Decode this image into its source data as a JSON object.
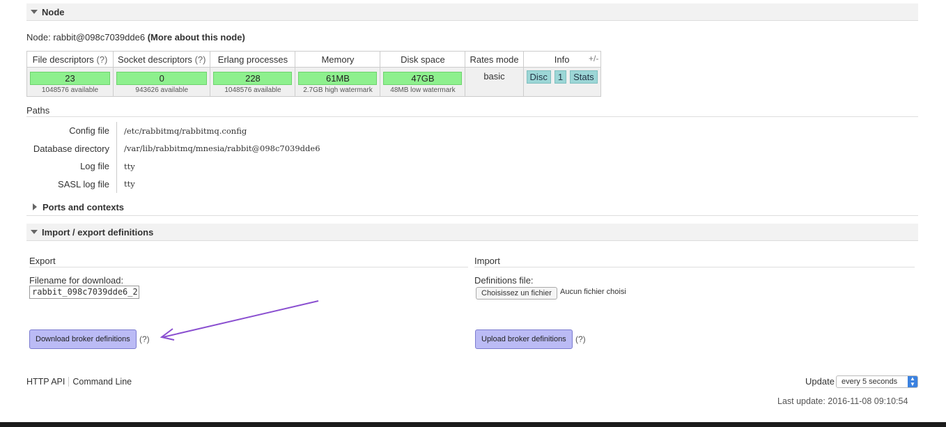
{
  "node_section": {
    "title": "Node",
    "node_prefix": "Node: ",
    "node_name": "rabbit@098c7039dde6",
    "more_link": "(More about this node)",
    "columns": [
      {
        "label": "File descriptors",
        "help": "(?)"
      },
      {
        "label": "Socket descriptors",
        "help": "(?)"
      },
      {
        "label": "Erlang processes",
        "help": ""
      },
      {
        "label": "Memory",
        "help": ""
      },
      {
        "label": "Disk space",
        "help": ""
      },
      {
        "label": "Rates mode",
        "help": ""
      },
      {
        "label": "Info",
        "help": ""
      }
    ],
    "file_descriptors": {
      "value": "23",
      "sub": "1048576 available"
    },
    "socket_descriptors": {
      "value": "0",
      "sub": "943626 available"
    },
    "erlang_processes": {
      "value": "228",
      "sub": "1048576 available"
    },
    "memory": {
      "value": "61MB",
      "sub": "2.7GB high watermark"
    },
    "disk_space": {
      "value": "47GB",
      "sub": "48MB low watermark"
    },
    "rates_mode": "basic",
    "info_badges": [
      "Disc",
      "1",
      "Stats"
    ],
    "plus_minus": "+/-"
  },
  "paths": {
    "title": "Paths",
    "rows": [
      {
        "key": "Config file",
        "value": "/etc/rabbitmq/rabbitmq.config"
      },
      {
        "key": "Database directory",
        "value": "/var/lib/rabbitmq/mnesia/rabbit@098c7039dde6"
      },
      {
        "key": "Log file",
        "value": "tty"
      },
      {
        "key": "SASL log file",
        "value": "tty"
      }
    ]
  },
  "ports_section": {
    "title": "Ports and contexts"
  },
  "import_export": {
    "title": "Import / export definitions",
    "export": {
      "heading": "Export",
      "filename_label": "Filename for download:",
      "filename_value": "rabbit_098c7039dde6_2",
      "button": "Download broker definitions",
      "help": "(?)"
    },
    "import": {
      "heading": "Import",
      "file_label": "Definitions file:",
      "choose_button": "Choisissez un fichier",
      "no_file": "Aucun fichier choisi",
      "button": "Upload broker definitions",
      "help": "(?)"
    }
  },
  "footer": {
    "links": [
      "HTTP API",
      "Command Line"
    ],
    "update_label": "Update",
    "update_value": "every 5 seconds",
    "last_update": "Last update: 2016-11-08 09:10:54"
  },
  "colors": {
    "bar_green": "#8ef08e",
    "badge_teal": "#9cd6d6",
    "button_purple": "#bbbbf5",
    "arrow": "#8a4fd0"
  }
}
